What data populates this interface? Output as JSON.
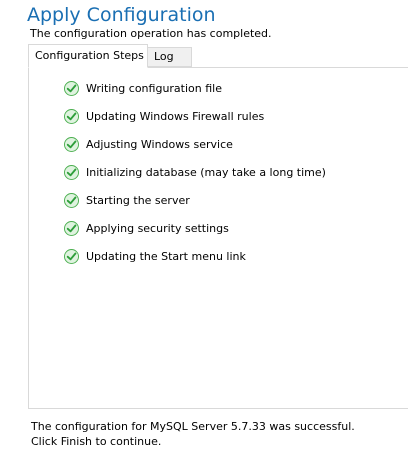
{
  "header": {
    "title": "Apply Configuration",
    "subtitle": "The configuration operation has completed."
  },
  "tabs": [
    {
      "label": "Configuration Steps",
      "active": true
    },
    {
      "label": "Log",
      "active": false
    }
  ],
  "steps": [
    {
      "label": "Writing configuration file",
      "status": "complete",
      "icon": "check-icon"
    },
    {
      "label": "Updating Windows Firewall rules",
      "status": "complete",
      "icon": "check-icon"
    },
    {
      "label": "Adjusting Windows service",
      "status": "complete",
      "icon": "check-icon"
    },
    {
      "label": "Initializing database (may take a long time)",
      "status": "complete",
      "icon": "check-icon"
    },
    {
      "label": "Starting the server",
      "status": "complete",
      "icon": "check-icon"
    },
    {
      "label": "Applying security settings",
      "status": "complete",
      "icon": "check-icon"
    },
    {
      "label": "Updating the Start menu link",
      "status": "complete",
      "icon": "check-icon"
    }
  ],
  "footer": {
    "line1": "The configuration for MySQL Server 5.7.33 was successful.",
    "line2": "Click Finish to continue."
  },
  "colors": {
    "title": "#1a6fb3",
    "check": "#2e9e3a"
  }
}
